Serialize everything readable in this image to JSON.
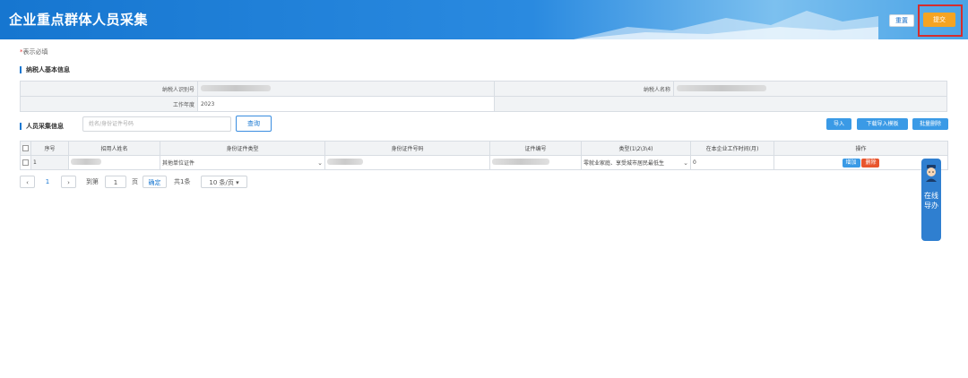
{
  "header": {
    "title": "企业重点群体人员采集",
    "reset_label": "重置",
    "submit_label": "提交"
  },
  "required_note": {
    "star": "*",
    "text": "表示必填"
  },
  "basic_info": {
    "section_title": "纳税人基本信息",
    "taxpayer_id_label": "纳税人识别号",
    "taxpayer_name_label": "纳税人名称",
    "work_year_label": "工作年度",
    "work_year_value": "2023"
  },
  "collection": {
    "section_title": "人员采集信息",
    "search_placeholder": "姓名/身份证件号码",
    "query_label": "查询",
    "import_label": "导入",
    "download_template_label": "下载导入模板",
    "batch_delete_label": "批量删除"
  },
  "table": {
    "columns": [
      "序号",
      "招用人姓名",
      "身份证件类型",
      "身份证件号码",
      "证件编号",
      "类型(1\\2\\3\\4)",
      "在本企业工作时间(月)",
      "操作"
    ],
    "rows": [
      {
        "index": "1",
        "id_type": "其他单位证件",
        "category": "零就业家庭、享受城市居民最低生",
        "months": "0",
        "add_label": "增加",
        "delete_label": "删除"
      }
    ]
  },
  "pagination": {
    "current_page": "1",
    "goto_label": "到第",
    "goto_value": "1",
    "page_unit": "页",
    "confirm_label": "确定",
    "total_label": "共1条",
    "page_size": "10 条/页"
  },
  "helper": {
    "text": "在线导办"
  },
  "colors": {
    "header_blue": "#1676d0",
    "submit_orange": "#f5a422",
    "delete_red": "#e8552d",
    "button_blue": "#3a9ae6"
  }
}
